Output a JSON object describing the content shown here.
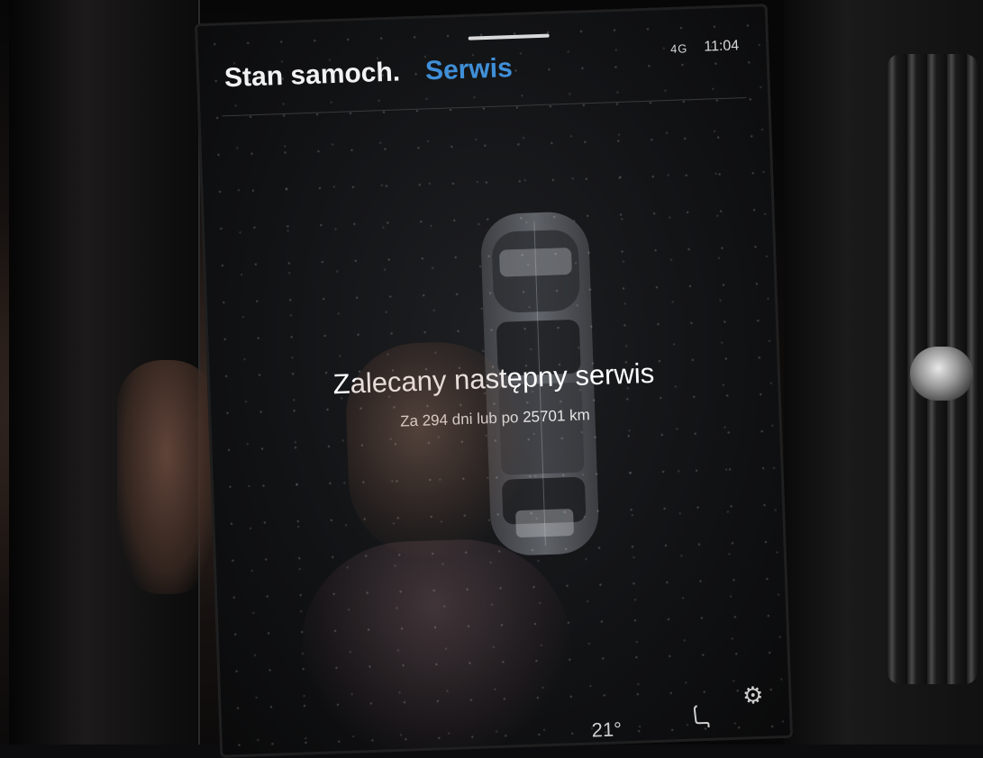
{
  "header": {
    "tabs": [
      {
        "label": "Stan samoch.",
        "active": true
      },
      {
        "label": "Serwis",
        "active": false
      }
    ]
  },
  "status_bar": {
    "signal": "4G",
    "time": "11:04"
  },
  "service": {
    "title": "Zalecany następny serwis",
    "subtitle": "Za 294 dni lub po 25701 km"
  },
  "footer": {
    "temperature": "21°"
  },
  "icons": {
    "settings": "gear-icon",
    "seat": "seat-icon",
    "car": "car-topview-icon"
  },
  "colors": {
    "accent": "#3f8fd8",
    "background": "#111214",
    "text": "#ffffff"
  }
}
